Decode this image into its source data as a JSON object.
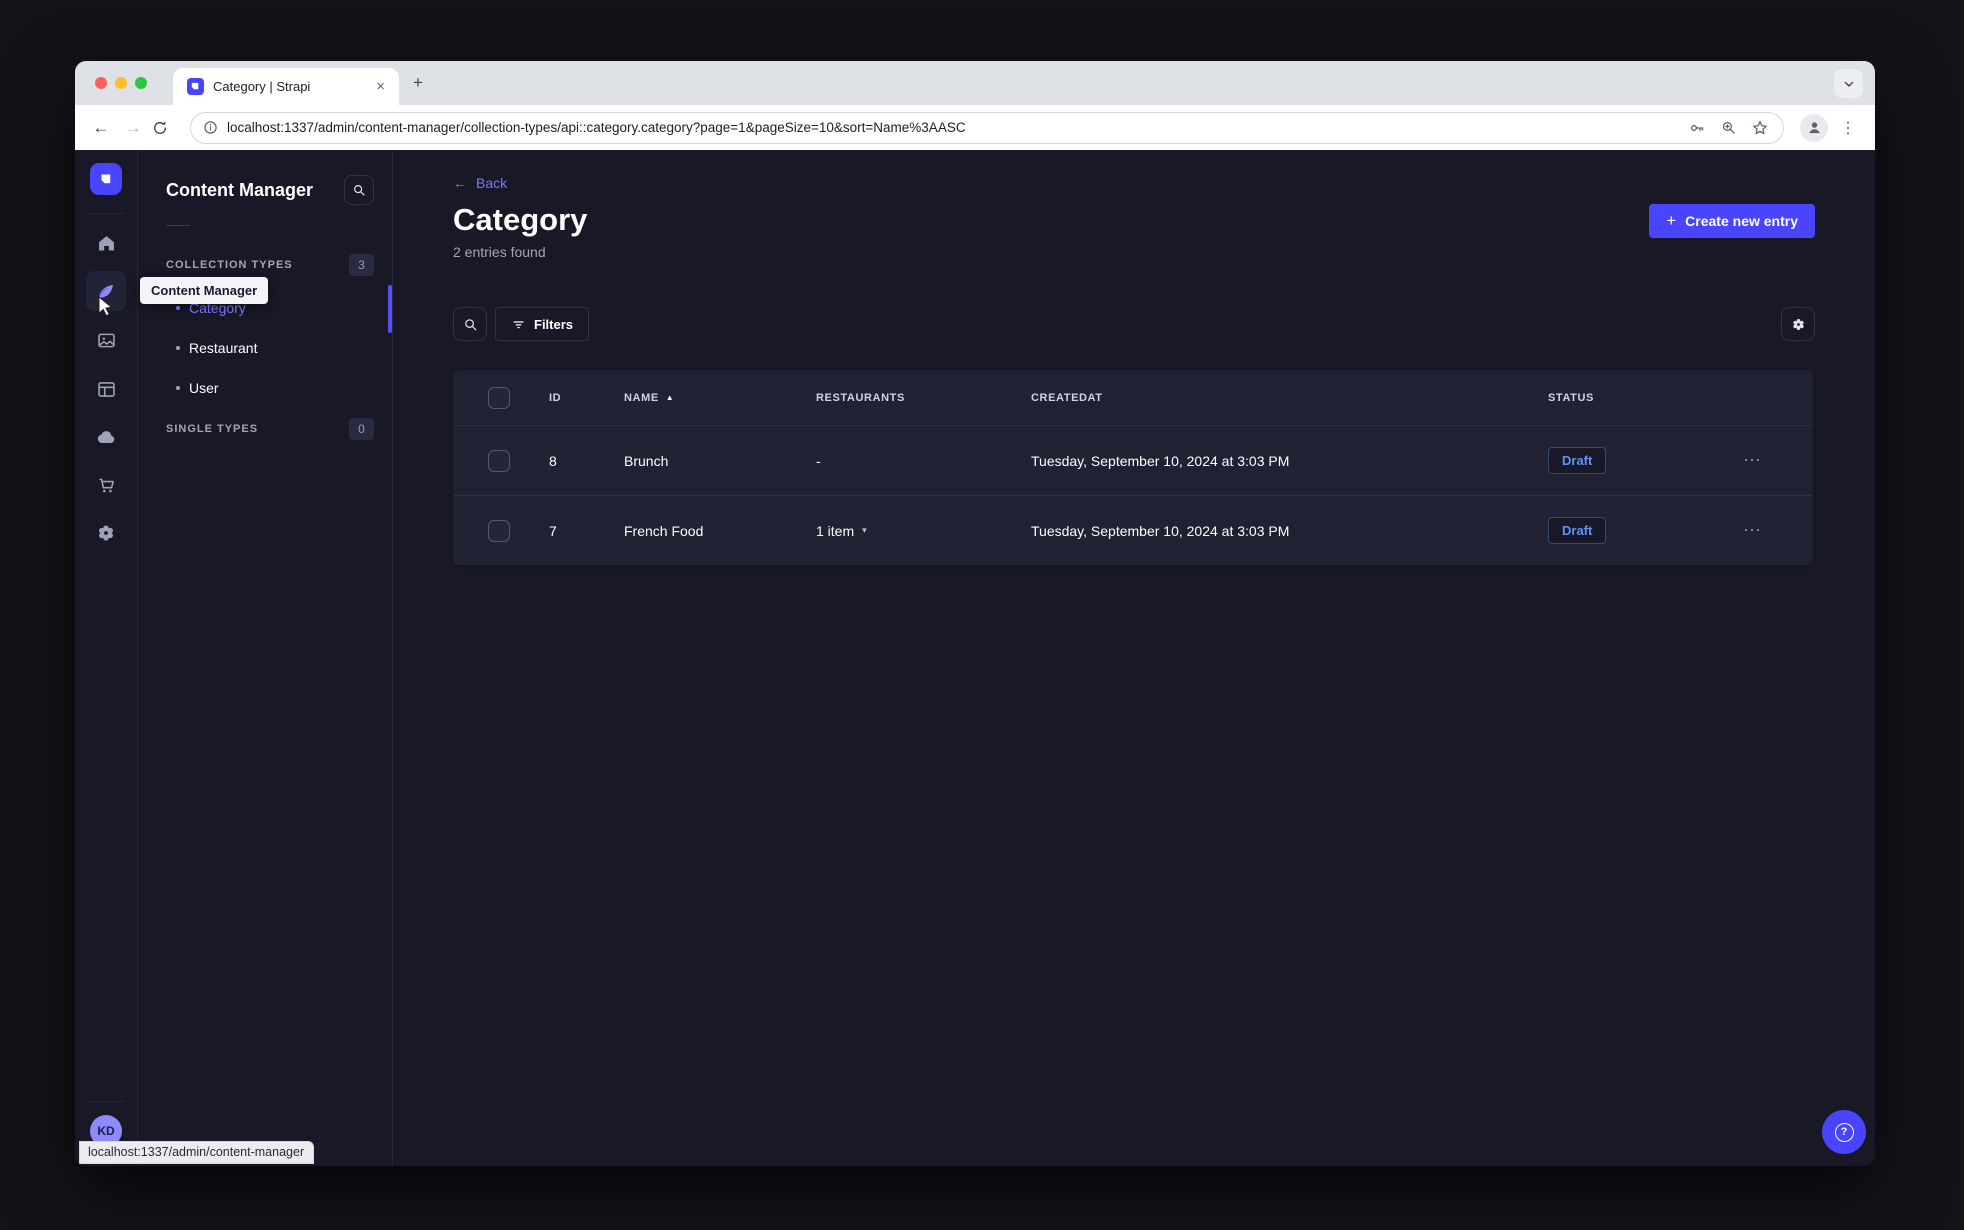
{
  "colors": {
    "accent": "#4945ff",
    "accent_light": "#7b79ff",
    "draft_blue": "#5d93f5",
    "bg": "#181826",
    "panel": "#212134",
    "border": "#32324d"
  },
  "icons": {
    "close": "×",
    "new_tab": "+",
    "back": "←",
    "forward": "→",
    "more_vertical": "⋮",
    "more_horizontal": "⋯",
    "sort_asc": "▲",
    "chevron_small_down": "▾",
    "plus": "+",
    "help": "?"
  },
  "browser": {
    "tab_title": "Category | Strapi",
    "url": "localhost:1337/admin/content-manager/collection-types/api::category.category?page=1&pageSize=10&sort=Name%3AASC",
    "status_bubble": "localhost:1337/admin/content-manager"
  },
  "sidebar": {
    "user_initials": "KD"
  },
  "subnav": {
    "title": "Content Manager",
    "tooltip": "Content Manager",
    "collection_types": {
      "label": "COLLECTION TYPES",
      "count": "3",
      "items": [
        {
          "label": "Category"
        },
        {
          "label": "Restaurant"
        },
        {
          "label": "User"
        }
      ]
    },
    "single_types": {
      "label": "SINGLE TYPES",
      "count": "0"
    }
  },
  "main": {
    "back_label": "Back",
    "title": "Category",
    "subtitle": "2 entries found",
    "create_button_label": "Create new entry",
    "filters_button_label": "Filters",
    "table": {
      "columns": {
        "id": "ID",
        "name": "NAME",
        "restaurants": "RESTAURANTS",
        "createdat": "CREATEDAT",
        "status": "STATUS"
      },
      "rows": [
        {
          "id": "8",
          "name": "Brunch",
          "restaurants": "-",
          "createdat": "Tuesday, September 10, 2024 at 3:03 PM",
          "status": "Draft"
        },
        {
          "id": "7",
          "name": "French Food",
          "restaurants": "1 item",
          "createdat": "Tuesday, September 10, 2024 at 3:03 PM",
          "status": "Draft"
        }
      ]
    }
  }
}
